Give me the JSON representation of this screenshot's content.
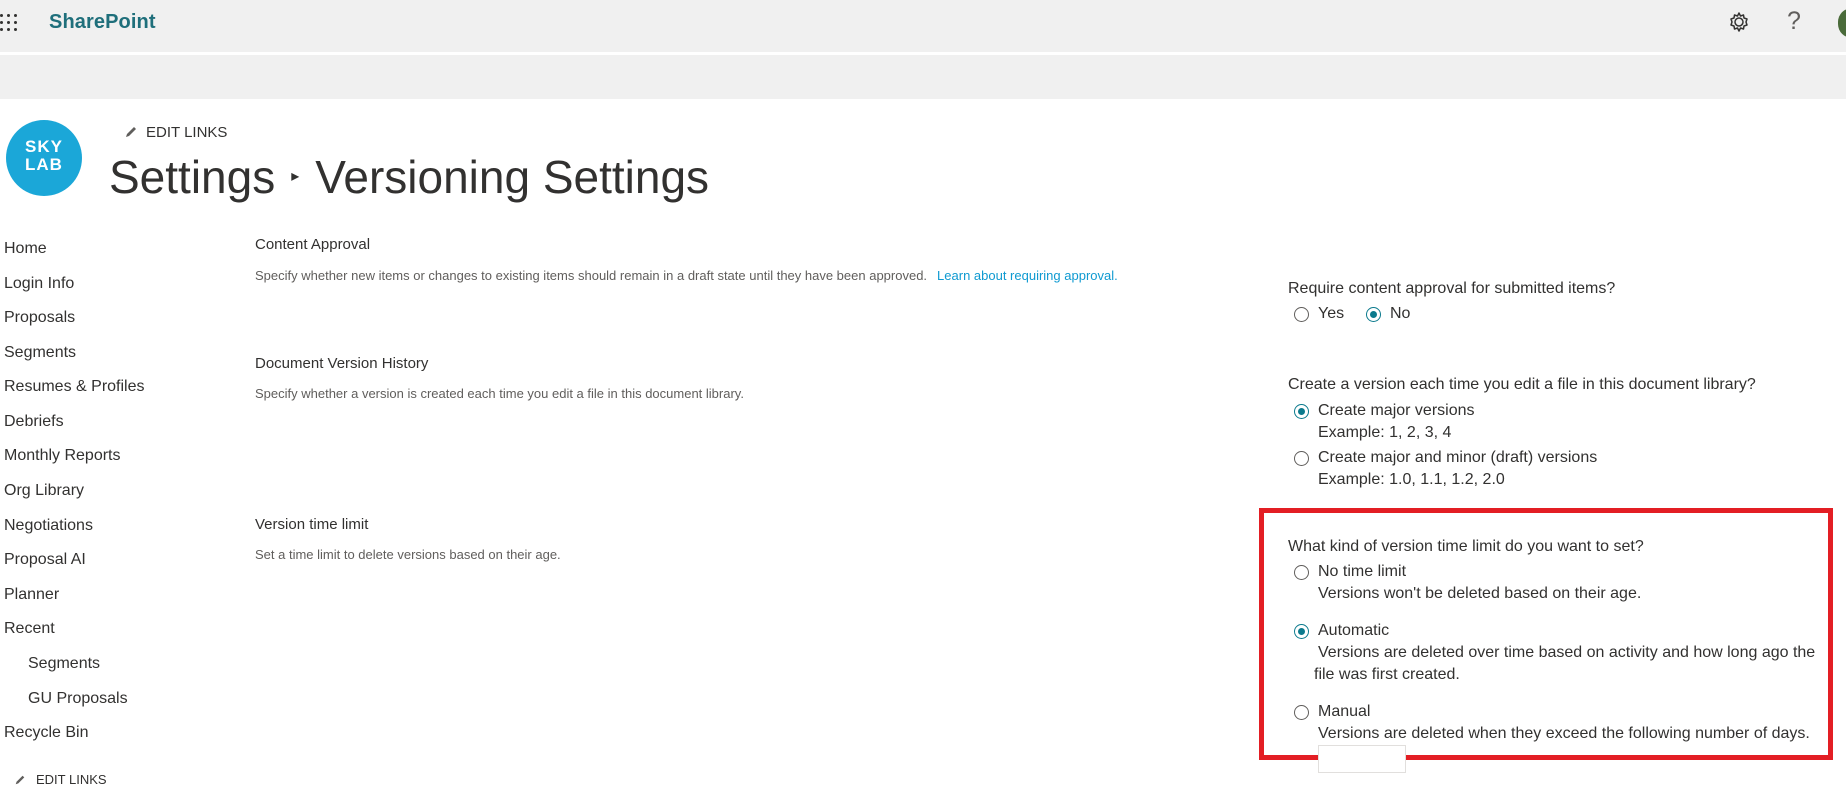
{
  "suite": {
    "brand": "SharePoint",
    "help_glyph": "?",
    "icons": [
      "waffle-icon",
      "gear-icon",
      "help-icon",
      "avatar"
    ]
  },
  "header": {
    "logo_line1": "SKY",
    "logo_line2": "LAB",
    "edit_links": "EDIT LINKS",
    "breadcrumb_root": "Settings",
    "breadcrumb_sep": "▸",
    "page_title": "Versioning Settings"
  },
  "nav": {
    "items": [
      {
        "label": "Home"
      },
      {
        "label": "Login Info"
      },
      {
        "label": "Proposals"
      },
      {
        "label": "Segments"
      },
      {
        "label": "Resumes & Profiles"
      },
      {
        "label": "Debriefs"
      },
      {
        "label": "Monthly Reports"
      },
      {
        "label": "Org Library"
      },
      {
        "label": "Negotiations"
      },
      {
        "label": "Proposal AI"
      },
      {
        "label": "Planner"
      },
      {
        "label": "Recent"
      },
      {
        "label": "Segments"
      },
      {
        "label": "GU Proposals"
      },
      {
        "label": "Recycle Bin"
      }
    ],
    "edit_links": "EDIT LINKS"
  },
  "content_approval": {
    "title": "Content Approval",
    "description": "Specify whether new items or changes to existing items should remain in a draft state until they have been approved.",
    "link": "Learn about requiring approval.",
    "question": "Require content approval for submitted items?",
    "options": [
      {
        "label": "Yes",
        "selected": false
      },
      {
        "label": "No",
        "selected": true
      }
    ]
  },
  "version_history": {
    "title": "Document Version History",
    "description": "Specify whether a version is created each time you edit a file in this document library.",
    "question": "Create a version each time you edit a file in this document library?",
    "options": [
      {
        "label": "Create major versions",
        "hint": "Example: 1, 2, 3, 4",
        "selected": true
      },
      {
        "label": "Create major and minor (draft) versions",
        "hint": "Example: 1.0, 1.1, 1.2, 2.0",
        "selected": false
      }
    ]
  },
  "time_limit": {
    "title": "Version time limit",
    "description": "Set a time limit to delete versions based on their age.",
    "question": "What kind of version time limit do you want to set?",
    "options": [
      {
        "label": "No time limit",
        "hint": "Versions won't be deleted based on their age.",
        "selected": false
      },
      {
        "label": "Automatic",
        "hint_line1": "Versions are deleted over time based on activity and how long ago the",
        "hint_line2": "file was first created.",
        "selected": true
      },
      {
        "label": "Manual",
        "hint": "Versions are deleted when they exceed the following number of days.",
        "selected": false
      }
    ],
    "days_value": ""
  },
  "colors": {
    "brand": "#1f6f7b",
    "accent": "#0b7a8d",
    "link": "#0f9ad1",
    "highlight": "#e31e24",
    "logo": "#1ba7d8"
  }
}
